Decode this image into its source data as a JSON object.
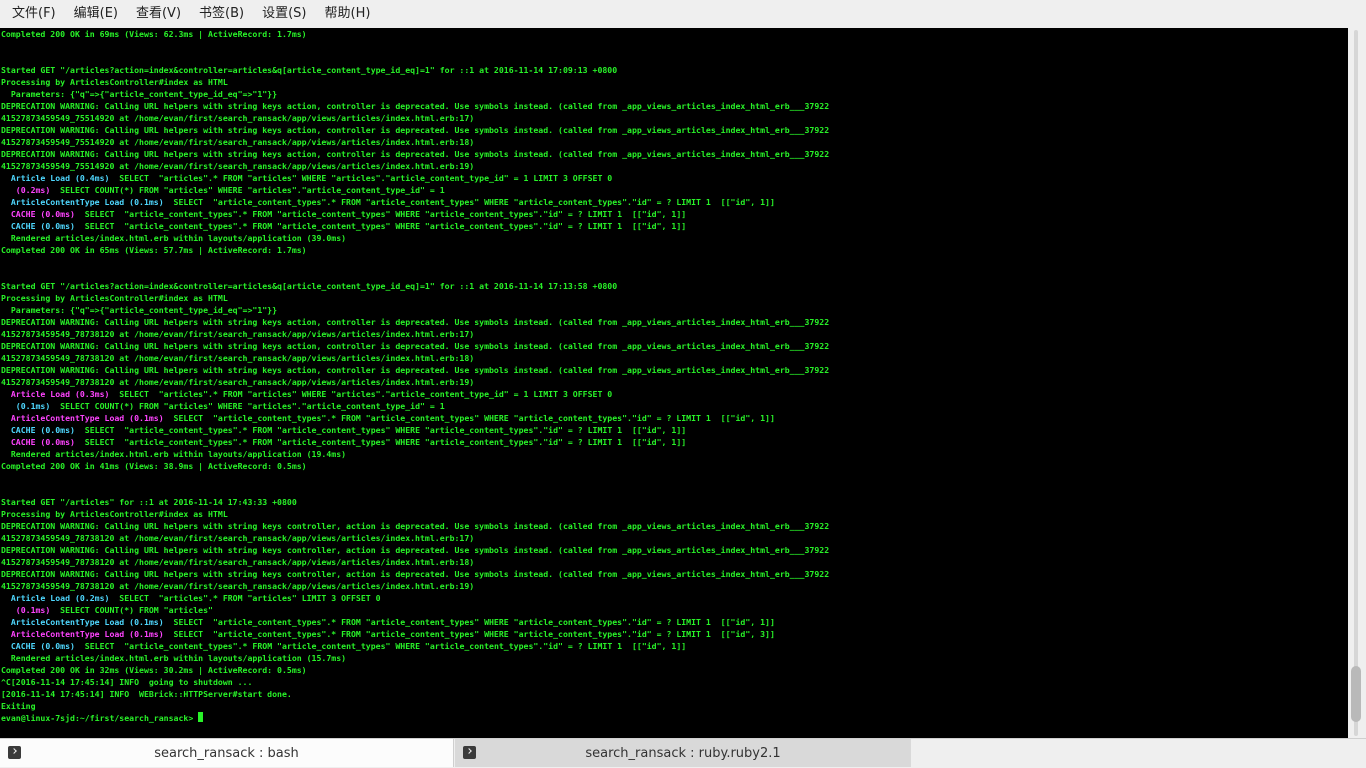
{
  "menubar": {
    "items": [
      "文件(F)",
      "编辑(E)",
      "查看(V)",
      "书签(B)",
      "设置(S)",
      "帮助(H)"
    ]
  },
  "colors": {
    "green": "#28f228",
    "cyan": "#4fd8ff",
    "magenta": "#ff44ff",
    "background": "#000000"
  },
  "terminal": {
    "lines": [
      [
        {
          "t": "Completed 200 OK in 69ms (Views: 62.3ms | ActiveRecord: 1.7ms)",
          "c": "g"
        }
      ],
      [],
      [],
      [
        {
          "t": "Started GET \"/articles?action=index&controller=articles&q[article_content_type_id_eq]=1\" for ::1 at 2016-11-14 17:09:13 +0800",
          "c": "g"
        }
      ],
      [
        {
          "t": "Processing by ArticlesController#index as HTML",
          "c": "g"
        }
      ],
      [
        {
          "t": "  Parameters: {\"q\"=>{\"article_content_type_id_eq\"=>\"1\"}}",
          "c": "g"
        }
      ],
      [
        {
          "t": "DEPRECATION WARNING: Calling URL helpers with string keys action, controller is deprecated. Use symbols instead. (called from _app_views_articles_index_html_erb___37922",
          "c": "g"
        }
      ],
      [
        {
          "t": "41527873459549_75514920 at /home/evan/first/search_ransack/app/views/articles/index.html.erb:17)",
          "c": "g"
        }
      ],
      [
        {
          "t": "DEPRECATION WARNING: Calling URL helpers with string keys action, controller is deprecated. Use symbols instead. (called from _app_views_articles_index_html_erb___37922",
          "c": "g"
        }
      ],
      [
        {
          "t": "41527873459549_75514920 at /home/evan/first/search_ransack/app/views/articles/index.html.erb:18)",
          "c": "g"
        }
      ],
      [
        {
          "t": "DEPRECATION WARNING: Calling URL helpers with string keys action, controller is deprecated. Use symbols instead. (called from _app_views_articles_index_html_erb___37922",
          "c": "g"
        }
      ],
      [
        {
          "t": "41527873459549_75514920 at /home/evan/first/search_ransack/app/views/articles/index.html.erb:19)",
          "c": "g"
        }
      ],
      [
        {
          "t": "  Article Load (0.4ms)",
          "c": "c"
        },
        {
          "t": "  SELECT  \"articles\".* FROM \"articles\" WHERE \"articles\".\"article_content_type_id\" = 1 LIMIT 3 OFFSET 0",
          "c": "g"
        }
      ],
      [
        {
          "t": "   (0.2ms)",
          "c": "m"
        },
        {
          "t": "  SELECT COUNT(*) FROM \"articles\" WHERE \"articles\".\"article_content_type_id\" = 1",
          "c": "g"
        }
      ],
      [
        {
          "t": "  ArticleContentType Load (0.1ms)",
          "c": "c"
        },
        {
          "t": "  SELECT  \"article_content_types\".* FROM \"article_content_types\" WHERE \"article_content_types\".\"id\" = ? LIMIT 1  [[\"id\", 1]]",
          "c": "g"
        }
      ],
      [
        {
          "t": "  CACHE (0.0ms)",
          "c": "m"
        },
        {
          "t": "  SELECT  \"article_content_types\".* FROM \"article_content_types\" WHERE \"article_content_types\".\"id\" = ? LIMIT 1  [[\"id\", 1]]",
          "c": "g"
        }
      ],
      [
        {
          "t": "  CACHE (0.0ms)",
          "c": "c"
        },
        {
          "t": "  SELECT  \"article_content_types\".* FROM \"article_content_types\" WHERE \"article_content_types\".\"id\" = ? LIMIT 1  [[\"id\", 1]]",
          "c": "g"
        }
      ],
      [
        {
          "t": "  Rendered articles/index.html.erb within layouts/application (39.0ms)",
          "c": "g"
        }
      ],
      [
        {
          "t": "Completed 200 OK in 65ms (Views: 57.7ms | ActiveRecord: 1.7ms)",
          "c": "g"
        }
      ],
      [],
      [],
      [
        {
          "t": "Started GET \"/articles?action=index&controller=articles&q[article_content_type_id_eq]=1\" for ::1 at 2016-11-14 17:13:58 +0800",
          "c": "g"
        }
      ],
      [
        {
          "t": "Processing by ArticlesController#index as HTML",
          "c": "g"
        }
      ],
      [
        {
          "t": "  Parameters: {\"q\"=>{\"article_content_type_id_eq\"=>\"1\"}}",
          "c": "g"
        }
      ],
      [
        {
          "t": "DEPRECATION WARNING: Calling URL helpers with string keys action, controller is deprecated. Use symbols instead. (called from _app_views_articles_index_html_erb___37922",
          "c": "g"
        }
      ],
      [
        {
          "t": "41527873459549_78738120 at /home/evan/first/search_ransack/app/views/articles/index.html.erb:17)",
          "c": "g"
        }
      ],
      [
        {
          "t": "DEPRECATION WARNING: Calling URL helpers with string keys action, controller is deprecated. Use symbols instead. (called from _app_views_articles_index_html_erb___37922",
          "c": "g"
        }
      ],
      [
        {
          "t": "41527873459549_78738120 at /home/evan/first/search_ransack/app/views/articles/index.html.erb:18)",
          "c": "g"
        }
      ],
      [
        {
          "t": "DEPRECATION WARNING: Calling URL helpers with string keys action, controller is deprecated. Use symbols instead. (called from _app_views_articles_index_html_erb___37922",
          "c": "g"
        }
      ],
      [
        {
          "t": "41527873459549_78738120 at /home/evan/first/search_ransack/app/views/articles/index.html.erb:19)",
          "c": "g"
        }
      ],
      [
        {
          "t": "  Article Load (0.3ms)",
          "c": "m"
        },
        {
          "t": "  SELECT  \"articles\".* FROM \"articles\" WHERE \"articles\".\"article_content_type_id\" = 1 LIMIT 3 OFFSET 0",
          "c": "g"
        }
      ],
      [
        {
          "t": "   (0.1ms)",
          "c": "c"
        },
        {
          "t": "  SELECT COUNT(*) FROM \"articles\" WHERE \"articles\".\"article_content_type_id\" = 1",
          "c": "g"
        }
      ],
      [
        {
          "t": "  ArticleContentType Load (0.1ms)",
          "c": "m"
        },
        {
          "t": "  SELECT  \"article_content_types\".* FROM \"article_content_types\" WHERE \"article_content_types\".\"id\" = ? LIMIT 1  [[\"id\", 1]]",
          "c": "g"
        }
      ],
      [
        {
          "t": "  CACHE (0.0ms)",
          "c": "c"
        },
        {
          "t": "  SELECT  \"article_content_types\".* FROM \"article_content_types\" WHERE \"article_content_types\".\"id\" = ? LIMIT 1  [[\"id\", 1]]",
          "c": "g"
        }
      ],
      [
        {
          "t": "  CACHE (0.0ms)",
          "c": "m"
        },
        {
          "t": "  SELECT  \"article_content_types\".* FROM \"article_content_types\" WHERE \"article_content_types\".\"id\" = ? LIMIT 1  [[\"id\", 1]]",
          "c": "g"
        }
      ],
      [
        {
          "t": "  Rendered articles/index.html.erb within layouts/application (19.4ms)",
          "c": "g"
        }
      ],
      [
        {
          "t": "Completed 200 OK in 41ms (Views: 38.9ms | ActiveRecord: 0.5ms)",
          "c": "g"
        }
      ],
      [],
      [],
      [
        {
          "t": "Started GET \"/articles\" for ::1 at 2016-11-14 17:43:33 +0800",
          "c": "g"
        }
      ],
      [
        {
          "t": "Processing by ArticlesController#index as HTML",
          "c": "g"
        }
      ],
      [
        {
          "t": "DEPRECATION WARNING: Calling URL helpers with string keys controller, action is deprecated. Use symbols instead. (called from _app_views_articles_index_html_erb___37922",
          "c": "g"
        }
      ],
      [
        {
          "t": "41527873459549_78738120 at /home/evan/first/search_ransack/app/views/articles/index.html.erb:17)",
          "c": "g"
        }
      ],
      [
        {
          "t": "DEPRECATION WARNING: Calling URL helpers with string keys controller, action is deprecated. Use symbols instead. (called from _app_views_articles_index_html_erb___37922",
          "c": "g"
        }
      ],
      [
        {
          "t": "41527873459549_78738120 at /home/evan/first/search_ransack/app/views/articles/index.html.erb:18)",
          "c": "g"
        }
      ],
      [
        {
          "t": "DEPRECATION WARNING: Calling URL helpers with string keys controller, action is deprecated. Use symbols instead. (called from _app_views_articles_index_html_erb___37922",
          "c": "g"
        }
      ],
      [
        {
          "t": "41527873459549_78738120 at /home/evan/first/search_ransack/app/views/articles/index.html.erb:19)",
          "c": "g"
        }
      ],
      [
        {
          "t": "  Article Load (0.2ms)",
          "c": "c"
        },
        {
          "t": "  SELECT  \"articles\".* FROM \"articles\" LIMIT 3 OFFSET 0",
          "c": "g"
        }
      ],
      [
        {
          "t": "   (0.1ms)",
          "c": "m"
        },
        {
          "t": "  SELECT COUNT(*) FROM \"articles\"",
          "c": "g"
        }
      ],
      [
        {
          "t": "  ArticleContentType Load (0.1ms)",
          "c": "c"
        },
        {
          "t": "  SELECT  \"article_content_types\".* FROM \"article_content_types\" WHERE \"article_content_types\".\"id\" = ? LIMIT 1  [[\"id\", 1]]",
          "c": "g"
        }
      ],
      [
        {
          "t": "  ArticleContentType Load (0.1ms)",
          "c": "m"
        },
        {
          "t": "  SELECT  \"article_content_types\".* FROM \"article_content_types\" WHERE \"article_content_types\".\"id\" = ? LIMIT 1  [[\"id\", 3]]",
          "c": "g"
        }
      ],
      [
        {
          "t": "  CACHE (0.0ms)",
          "c": "c"
        },
        {
          "t": "  SELECT  \"article_content_types\".* FROM \"article_content_types\" WHERE \"article_content_types\".\"id\" = ? LIMIT 1  [[\"id\", 1]]",
          "c": "g"
        }
      ],
      [
        {
          "t": "  Rendered articles/index.html.erb within layouts/application (15.7ms)",
          "c": "g"
        }
      ],
      [
        {
          "t": "Completed 200 OK in 32ms (Views: 30.2ms | ActiveRecord: 0.5ms)",
          "c": "g"
        }
      ],
      [
        {
          "t": "^C[2016-11-14 17:45:14] INFO  going to shutdown ...",
          "c": "g"
        }
      ],
      [
        {
          "t": "[2016-11-14 17:45:14] INFO  WEBrick::HTTPServer#start done.",
          "c": "g"
        }
      ],
      [
        {
          "t": "Exiting",
          "c": "g"
        }
      ],
      [
        {
          "t": "evan@linux-7sjd:~/first/search_ransack> ",
          "c": "g"
        }
      ]
    ],
    "prompt_line_index": 57
  },
  "tabs": [
    {
      "label": "search_ransack : bash",
      "icon": "terminal-icon",
      "active": true
    },
    {
      "label": "search_ransack : ruby.ruby2.1",
      "icon": "terminal-icon",
      "active": false
    }
  ]
}
